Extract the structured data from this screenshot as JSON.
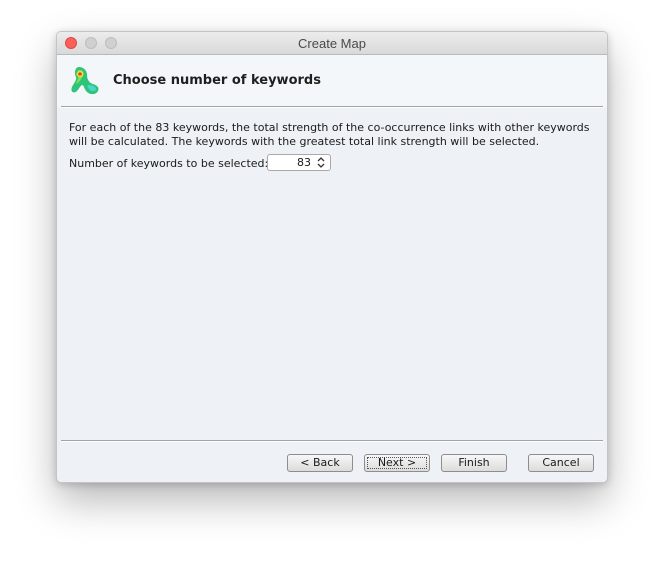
{
  "window": {
    "title": "Create Map"
  },
  "header": {
    "heading": "Choose number of keywords",
    "logo_icon": "vosviewer-logo-icon"
  },
  "content": {
    "description_line1": "For each of the 83 keywords, the total strength of the co-occurrence links with other keywords",
    "description_line2": "will be calculated. The keywords with the greatest total link strength will be selected.",
    "count_label": "Number of keywords to be selected:",
    "count_value": "83"
  },
  "buttons": {
    "back": "< Back",
    "next": "Next >",
    "finish": "Finish",
    "cancel": "Cancel"
  },
  "colors": {
    "close_button": "#fc605c",
    "window_background": "#eef2f6"
  }
}
